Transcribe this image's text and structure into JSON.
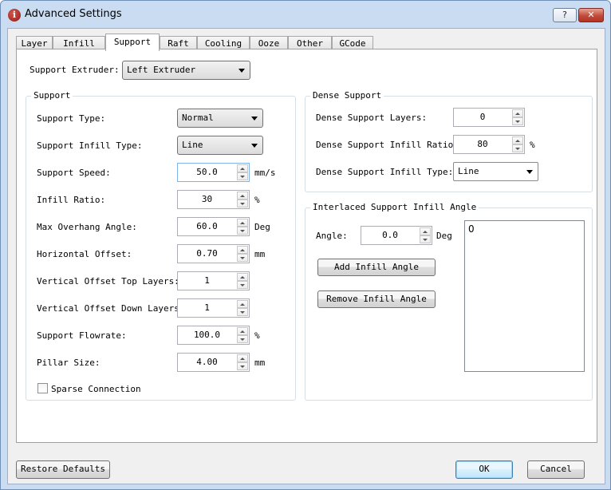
{
  "window": {
    "title": "Advanced Settings",
    "help_label": "?",
    "close_label": "✕"
  },
  "tabs": [
    "Layer",
    "Infill",
    "Support",
    "Raft",
    "Cooling",
    "Ooze",
    "Other",
    "GCode"
  ],
  "active_tab": "Support",
  "support_extruder": {
    "label": "Support Extruder:",
    "value": "Left Extruder"
  },
  "support_group": {
    "title": "Support",
    "support_type": {
      "label": "Support Type:",
      "value": "Normal"
    },
    "support_infill_type": {
      "label": "Support Infill Type:",
      "value": "Line"
    },
    "support_speed": {
      "label": "Support Speed:",
      "value": "50.0",
      "unit": "mm/s"
    },
    "infill_ratio": {
      "label": "Infill Ratio:",
      "value": "30",
      "unit": "%"
    },
    "max_overhang_angle": {
      "label": "Max Overhang Angle:",
      "value": "60.0",
      "unit": "Deg"
    },
    "horizontal_offset": {
      "label": "Horizontal Offset:",
      "value": "0.70",
      "unit": "mm"
    },
    "vertical_offset_top": {
      "label": "Vertical Offset Top Layers:",
      "value": "1"
    },
    "vertical_offset_down": {
      "label": "Vertical Offset Down Layers:",
      "value": "1"
    },
    "support_flowrate": {
      "label": "Support Flowrate:",
      "value": "100.0",
      "unit": "%"
    },
    "pillar_size": {
      "label": "Pillar Size:",
      "value": "4.00",
      "unit": "mm"
    },
    "sparse_connection": {
      "label": "Sparse Connection",
      "checked": false
    }
  },
  "dense_group": {
    "title": "Dense Support",
    "layers": {
      "label": "Dense Support Layers:",
      "value": "0"
    },
    "infill_ratio": {
      "label": "Dense Support Infill Ratio:",
      "value": "80",
      "unit": "%"
    },
    "infill_type": {
      "label": "Dense Support Infill Type:",
      "value": "Line"
    }
  },
  "interlaced_group": {
    "title": "Interlaced Support Infill Angle",
    "angle": {
      "label": "Angle:",
      "value": "0.0",
      "unit": "Deg"
    },
    "add_label": "Add Infill Angle",
    "remove_label": "Remove Infill Angle",
    "angles": [
      "0"
    ]
  },
  "footer": {
    "restore_label": "Restore Defaults",
    "ok_label": "OK",
    "cancel_label": "Cancel"
  }
}
